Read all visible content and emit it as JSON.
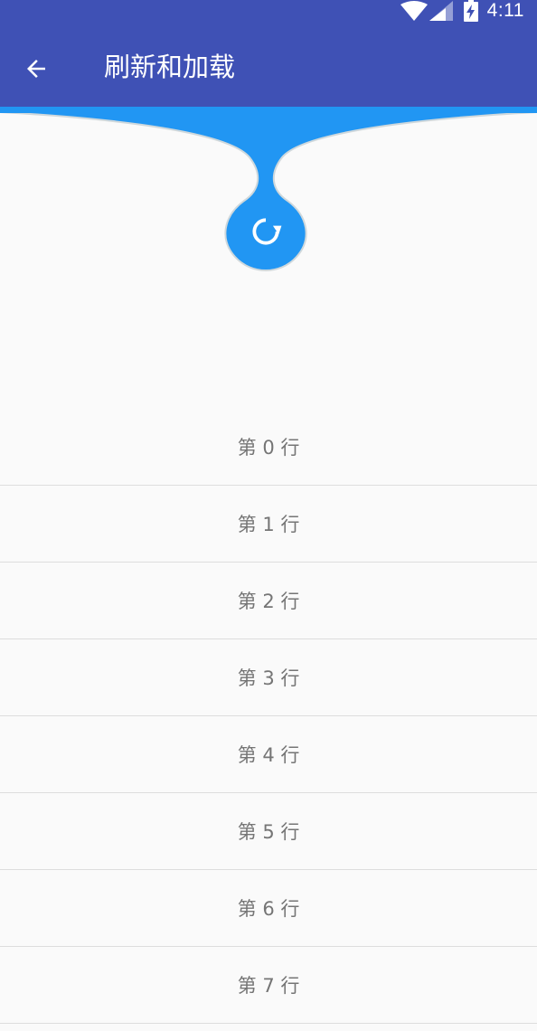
{
  "status_bar": {
    "time": "4:11"
  },
  "app_bar": {
    "title": "刷新和加载",
    "back_icon": "arrow-back-icon"
  },
  "refresh": {
    "icon": "refresh-icon",
    "color": "#2196F3"
  },
  "colors": {
    "primary": "#3F51B5",
    "accent": "#2196F3",
    "background": "#FAFAFA",
    "row_text": "#757575",
    "divider": "#DDDDDD"
  },
  "list": {
    "items": [
      {
        "label": "第 0 行"
      },
      {
        "label": "第 1 行"
      },
      {
        "label": "第 2 行"
      },
      {
        "label": "第 3 行"
      },
      {
        "label": "第 4 行"
      },
      {
        "label": "第 5 行"
      },
      {
        "label": "第 6 行"
      },
      {
        "label": "第 7 行"
      }
    ]
  }
}
